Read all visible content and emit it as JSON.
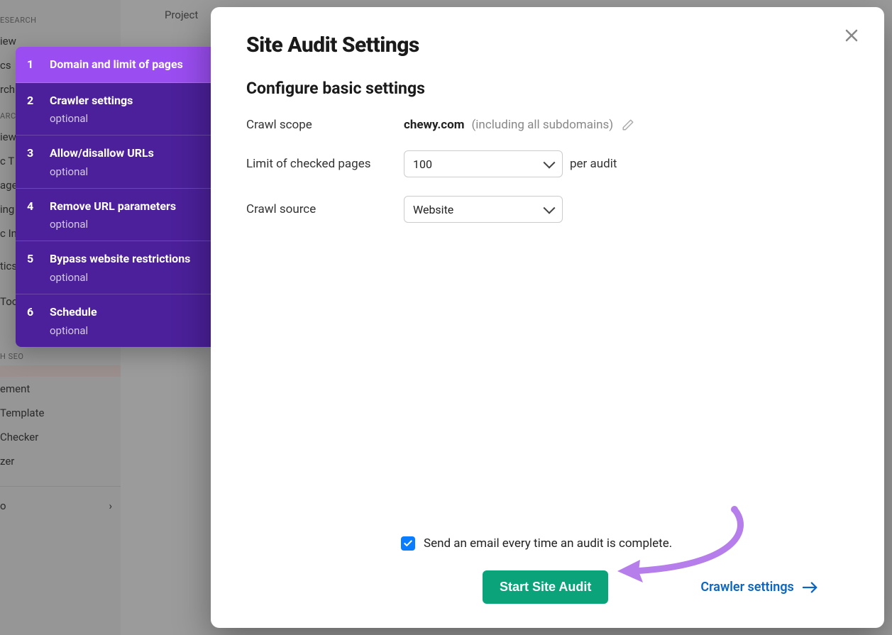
{
  "background": {
    "nav": {
      "section1_label": "ESEARCH",
      "section1_items": [
        "iew",
        "cs",
        "rch"
      ],
      "section2_label": "ARCH",
      "section2_items": [
        "iew",
        "c T",
        "age",
        "ing",
        "c In",
        "tics",
        "Tool"
      ],
      "section3_label": "H SEO",
      "section3_items": [
        "",
        "ement",
        "Template",
        "Checker",
        "zer"
      ],
      "expand_label": "o"
    },
    "tab_label": "Project"
  },
  "steps": [
    {
      "num": "1",
      "title": "Domain and limit of pages",
      "optional": false,
      "active": true
    },
    {
      "num": "2",
      "title": "Crawler settings",
      "optional": true,
      "active": false
    },
    {
      "num": "3",
      "title": "Allow/disallow URLs",
      "optional": true,
      "active": false
    },
    {
      "num": "4",
      "title": "Remove URL parameters",
      "optional": true,
      "active": false
    },
    {
      "num": "5",
      "title": "Bypass website restrictions",
      "optional": true,
      "active": false
    },
    {
      "num": "6",
      "title": "Schedule",
      "optional": true,
      "active": false
    }
  ],
  "optional_label": "optional",
  "modal": {
    "title": "Site Audit Settings",
    "subtitle": "Configure basic settings",
    "crawl_scope_label": "Crawl scope",
    "crawl_scope_domain": "chewy.com",
    "crawl_scope_note": "(including all subdomains)",
    "limit_label": "Limit of checked pages",
    "limit_value": "100",
    "limit_suffix": "per audit",
    "source_label": "Crawl source",
    "source_value": "Website",
    "email_label": "Send an email every time an audit is complete.",
    "email_checked": true,
    "start_button": "Start Site Audit",
    "next_link": "Crawler settings"
  }
}
